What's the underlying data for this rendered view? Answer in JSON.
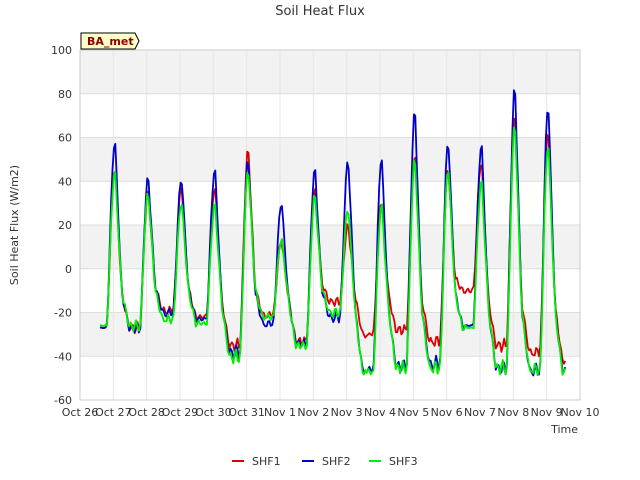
{
  "chart_data": {
    "type": "line",
    "title": "Soil Heat Flux",
    "xlabel": "Time",
    "ylabel": "Soil Heat Flux (W/m2)",
    "badge": "BA_met",
    "ylim": [
      -60,
      100
    ],
    "yticks": [
      -60,
      -40,
      -20,
      0,
      20,
      40,
      60,
      80,
      100
    ],
    "xlim": [
      0,
      15
    ],
    "xtick_labels": [
      "Oct 26",
      "Oct 27",
      "Oct 28",
      "Oct 29",
      "Oct 30",
      "Oct 31",
      "Nov 1",
      "Nov 2",
      "Nov 3",
      "Nov 4",
      "Nov 5",
      "Nov 6",
      "Nov 7",
      "Nov 8",
      "Nov 9",
      "Nov 10"
    ],
    "grid": true,
    "legend_position": "bottom-center",
    "series": [
      {
        "name": "SHF1",
        "color": "#dd0000",
        "daily_max": [
          47,
          36,
          38,
          38,
          55,
          13,
          37,
          20,
          32,
          52,
          46,
          50,
          71,
          64
        ],
        "daily_min": [
          -27,
          -19,
          -22,
          -35,
          -21,
          -33,
          -15,
          -30,
          -28,
          -33,
          -10,
          -35,
          -38,
          -42
        ]
      },
      {
        "name": "SHF2",
        "color": "#0000cc",
        "daily_max": [
          59,
          42,
          42,
          46,
          50,
          31,
          46,
          50,
          52,
          73,
          59,
          58,
          84,
          76
        ],
        "daily_min": [
          -27,
          -20,
          -23,
          -38,
          -25,
          -34,
          -22,
          -46,
          -44,
          -43,
          -26,
          -45,
          -46,
          -46
        ]
      },
      {
        "name": "SHF3",
        "color": "#00ee00",
        "daily_max": [
          45,
          35,
          31,
          30,
          46,
          14,
          34,
          28,
          30,
          51,
          47,
          41,
          67,
          58
        ],
        "daily_min": [
          -26,
          -23,
          -25,
          -40,
          -22,
          -35,
          -20,
          -47,
          -45,
          -45,
          -27,
          -45,
          -46,
          -47
        ]
      }
    ]
  }
}
